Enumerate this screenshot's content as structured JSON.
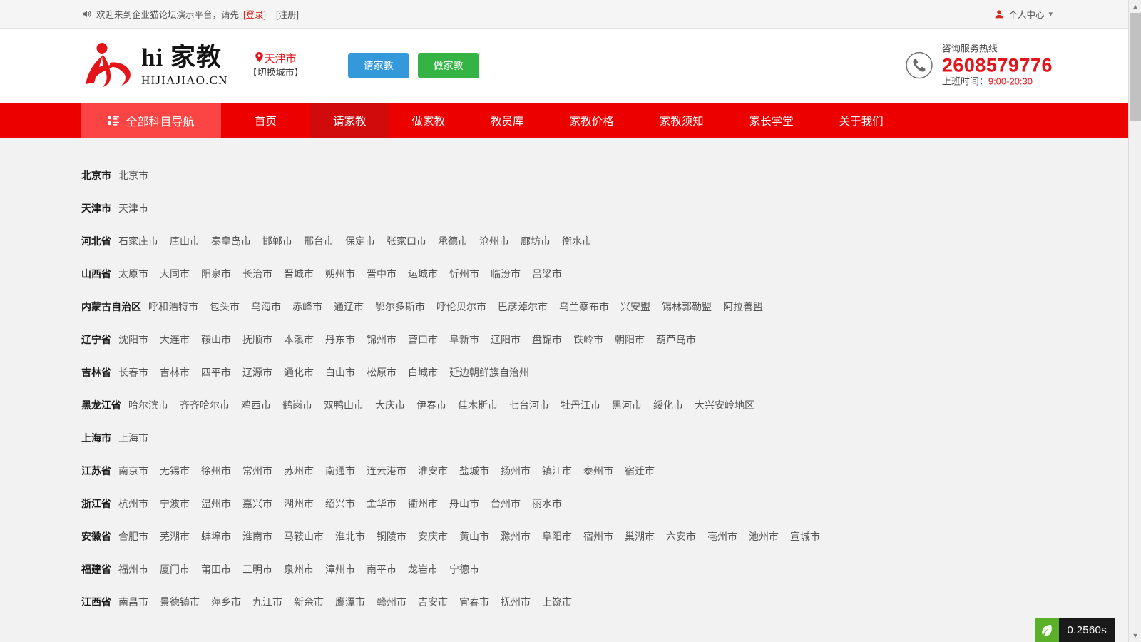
{
  "topbar": {
    "speaker_icon": "speaker-icon",
    "welcome_text": "欢迎来到企业猫论坛演示平台，请先",
    "login_label": "[登录]",
    "register_label": "[注册]",
    "user_icon": "user-icon",
    "user_center_label": "个人中心",
    "caret_icon": "chevron-down-icon"
  },
  "header": {
    "logo_title": "hi 家教",
    "logo_subtitle": "HIJIAJIAO.CN",
    "pin_icon": "location-pin-icon",
    "city_name": "天津市",
    "city_switch_label": "【切换城市】",
    "btn_ask_label": "请家教",
    "btn_be_label": "做家教",
    "phone_icon": "phone-icon",
    "hotline_label": "咨询服务热线",
    "hotline_number": "2608579776",
    "hotline_hours_label": "上班时间：",
    "hotline_hours_value": "9:00-20:30",
    "accent_red": "#e4151a",
    "btn_ask_color": "#3499db",
    "btn_be_color": "#35b445"
  },
  "nav": {
    "grid_icon": "grid-icon",
    "subjects_label": "全部科目导航",
    "subjects_bg": "#fb4545",
    "bar_bg": "#ec0000",
    "active_bg": "#d10b0b",
    "items": [
      {
        "label": "首页",
        "active": false
      },
      {
        "label": "请家教",
        "active": true
      },
      {
        "label": "做家教",
        "active": false
      },
      {
        "label": "教员库",
        "active": false
      },
      {
        "label": "家教价格",
        "active": false
      },
      {
        "label": "家教须知",
        "active": false
      },
      {
        "label": "家长学堂",
        "active": false
      },
      {
        "label": "关于我们",
        "active": false
      }
    ]
  },
  "city_list": [
    {
      "province": "北京市",
      "cities": [
        "北京市"
      ]
    },
    {
      "province": "天津市",
      "cities": [
        "天津市"
      ]
    },
    {
      "province": "河北省",
      "cities": [
        "石家庄市",
        "唐山市",
        "秦皇岛市",
        "邯郸市",
        "邢台市",
        "保定市",
        "张家口市",
        "承德市",
        "沧州市",
        "廊坊市",
        "衡水市"
      ]
    },
    {
      "province": "山西省",
      "cities": [
        "太原市",
        "大同市",
        "阳泉市",
        "长治市",
        "晋城市",
        "朔州市",
        "晋中市",
        "运城市",
        "忻州市",
        "临汾市",
        "吕梁市"
      ]
    },
    {
      "province": "内蒙古自治区",
      "cities": [
        "呼和浩特市",
        "包头市",
        "乌海市",
        "赤峰市",
        "通辽市",
        "鄂尔多斯市",
        "呼伦贝尔市",
        "巴彦淖尔市",
        "乌兰察布市",
        "兴安盟",
        "锡林郭勒盟",
        "阿拉善盟"
      ]
    },
    {
      "province": "辽宁省",
      "cities": [
        "沈阳市",
        "大连市",
        "鞍山市",
        "抚顺市",
        "本溪市",
        "丹东市",
        "锦州市",
        "营口市",
        "阜新市",
        "辽阳市",
        "盘锦市",
        "铁岭市",
        "朝阳市",
        "葫芦岛市"
      ]
    },
    {
      "province": "吉林省",
      "cities": [
        "长春市",
        "吉林市",
        "四平市",
        "辽源市",
        "通化市",
        "白山市",
        "松原市",
        "白城市",
        "延边朝鲜族自治州"
      ]
    },
    {
      "province": "黑龙江省",
      "cities": [
        "哈尔滨市",
        "齐齐哈尔市",
        "鸡西市",
        "鹤岗市",
        "双鸭山市",
        "大庆市",
        "伊春市",
        "佳木斯市",
        "七台河市",
        "牡丹江市",
        "黑河市",
        "绥化市",
        "大兴安岭地区"
      ]
    },
    {
      "province": "上海市",
      "cities": [
        "上海市"
      ]
    },
    {
      "province": "江苏省",
      "cities": [
        "南京市",
        "无锡市",
        "徐州市",
        "常州市",
        "苏州市",
        "南通市",
        "连云港市",
        "淮安市",
        "盐城市",
        "扬州市",
        "镇江市",
        "泰州市",
        "宿迁市"
      ]
    },
    {
      "province": "浙江省",
      "cities": [
        "杭州市",
        "宁波市",
        "温州市",
        "嘉兴市",
        "湖州市",
        "绍兴市",
        "金华市",
        "衢州市",
        "舟山市",
        "台州市",
        "丽水市"
      ]
    },
    {
      "province": "安徽省",
      "cities": [
        "合肥市",
        "芜湖市",
        "蚌埠市",
        "淮南市",
        "马鞍山市",
        "淮北市",
        "铜陵市",
        "安庆市",
        "黄山市",
        "滁州市",
        "阜阳市",
        "宿州市",
        "巢湖市",
        "六安市",
        "亳州市",
        "池州市",
        "宣城市"
      ]
    },
    {
      "province": "福建省",
      "cities": [
        "福州市",
        "厦门市",
        "莆田市",
        "三明市",
        "泉州市",
        "漳州市",
        "南平市",
        "龙岩市",
        "宁德市"
      ]
    },
    {
      "province": "江西省",
      "cities": [
        "南昌市",
        "景德镇市",
        "萍乡市",
        "九江市",
        "新余市",
        "鹰潭市",
        "赣州市",
        "吉安市",
        "宜春市",
        "抚州市",
        "上饶市"
      ]
    }
  ],
  "perf_badge": {
    "leaf_icon": "leaf-icon",
    "time_label": "0.2560s",
    "leaf_bg": "#5ab028"
  },
  "scrollbar": {
    "up_arrow_icon": "triangle-up-icon",
    "down_arrow_icon": "triangle-down-icon"
  }
}
